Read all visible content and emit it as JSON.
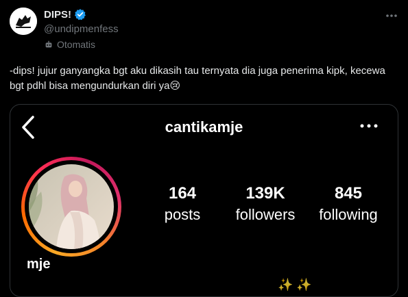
{
  "tweet": {
    "display_name": "DIPS!",
    "handle": "@undipmenfess",
    "automated_label": "Otomatis",
    "text": "-dips! jujur ganyangka bgt aku dikasih tau ternyata dia juga penerima kipk, kecewa bgt pdhl bisa mengundurkan diri ya😢",
    "more_icon": "more-horizontal-icon",
    "verified_color": "#1d9bf0"
  },
  "instagram": {
    "username": "cantikamje",
    "profile_name": "mje",
    "stats": [
      {
        "value": "164",
        "label": "posts"
      },
      {
        "value": "139K",
        "label": "followers"
      },
      {
        "value": "845",
        "label": "following"
      }
    ]
  }
}
